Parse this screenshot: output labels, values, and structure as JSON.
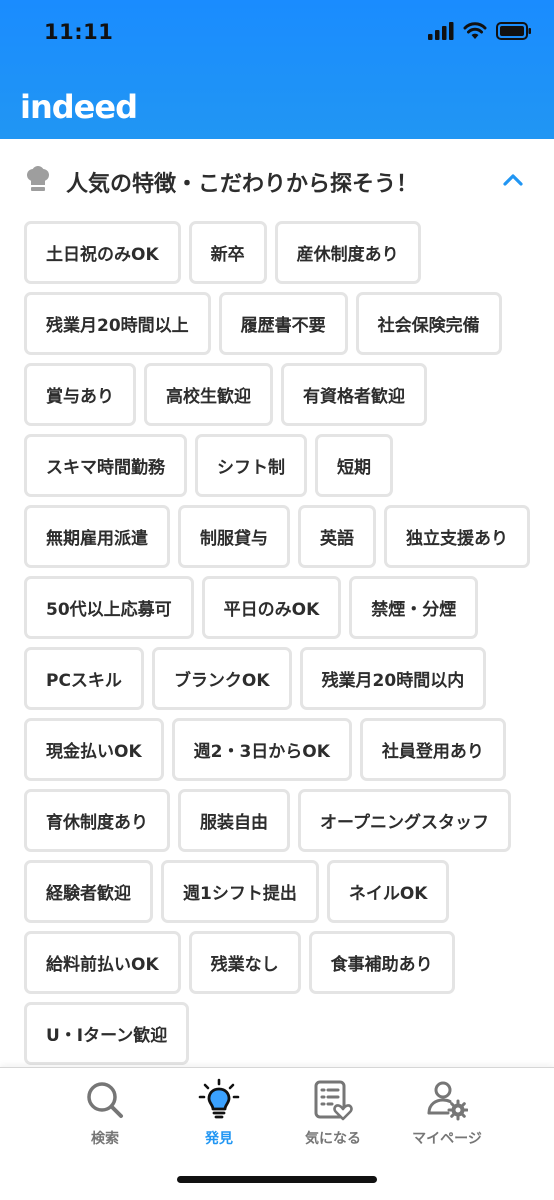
{
  "status": {
    "time": "11:11"
  },
  "header": {
    "logo": "indeed"
  },
  "section": {
    "title": "人気の特徴・こだわりから探そう！"
  },
  "tags": [
    "土日祝のみOK",
    "新卒",
    "産休制度あり",
    "残業月20時間以上",
    "履歴書不要",
    "社会保険完備",
    "賞与あり",
    "高校生歓迎",
    "有資格者歓迎",
    "スキマ時間勤務",
    "シフト制",
    "短期",
    "無期雇用派遣",
    "制服貸与",
    "英語",
    "独立支援あり",
    "50代以上応募可",
    "平日のみOK",
    "禁煙・分煙",
    "PCスキル",
    "ブランクOK",
    "残業月20時間以内",
    "現金払いOK",
    "週2・3日からOK",
    "社員登用あり",
    "育休制度あり",
    "服装自由",
    "オープニングスタッフ",
    "経験者歓迎",
    "週1シフト提出",
    "ネイルOK",
    "給料前払いOK",
    "残業なし",
    "食事補助あり",
    "U・Iターン歓迎"
  ],
  "nav": {
    "search": "検索",
    "discover": "発見",
    "saved": "気になる",
    "mypage": "マイページ"
  },
  "colors": {
    "brand": "#2196f3",
    "tag_border": "#e4e4e4",
    "text": "#2d2d2d"
  }
}
